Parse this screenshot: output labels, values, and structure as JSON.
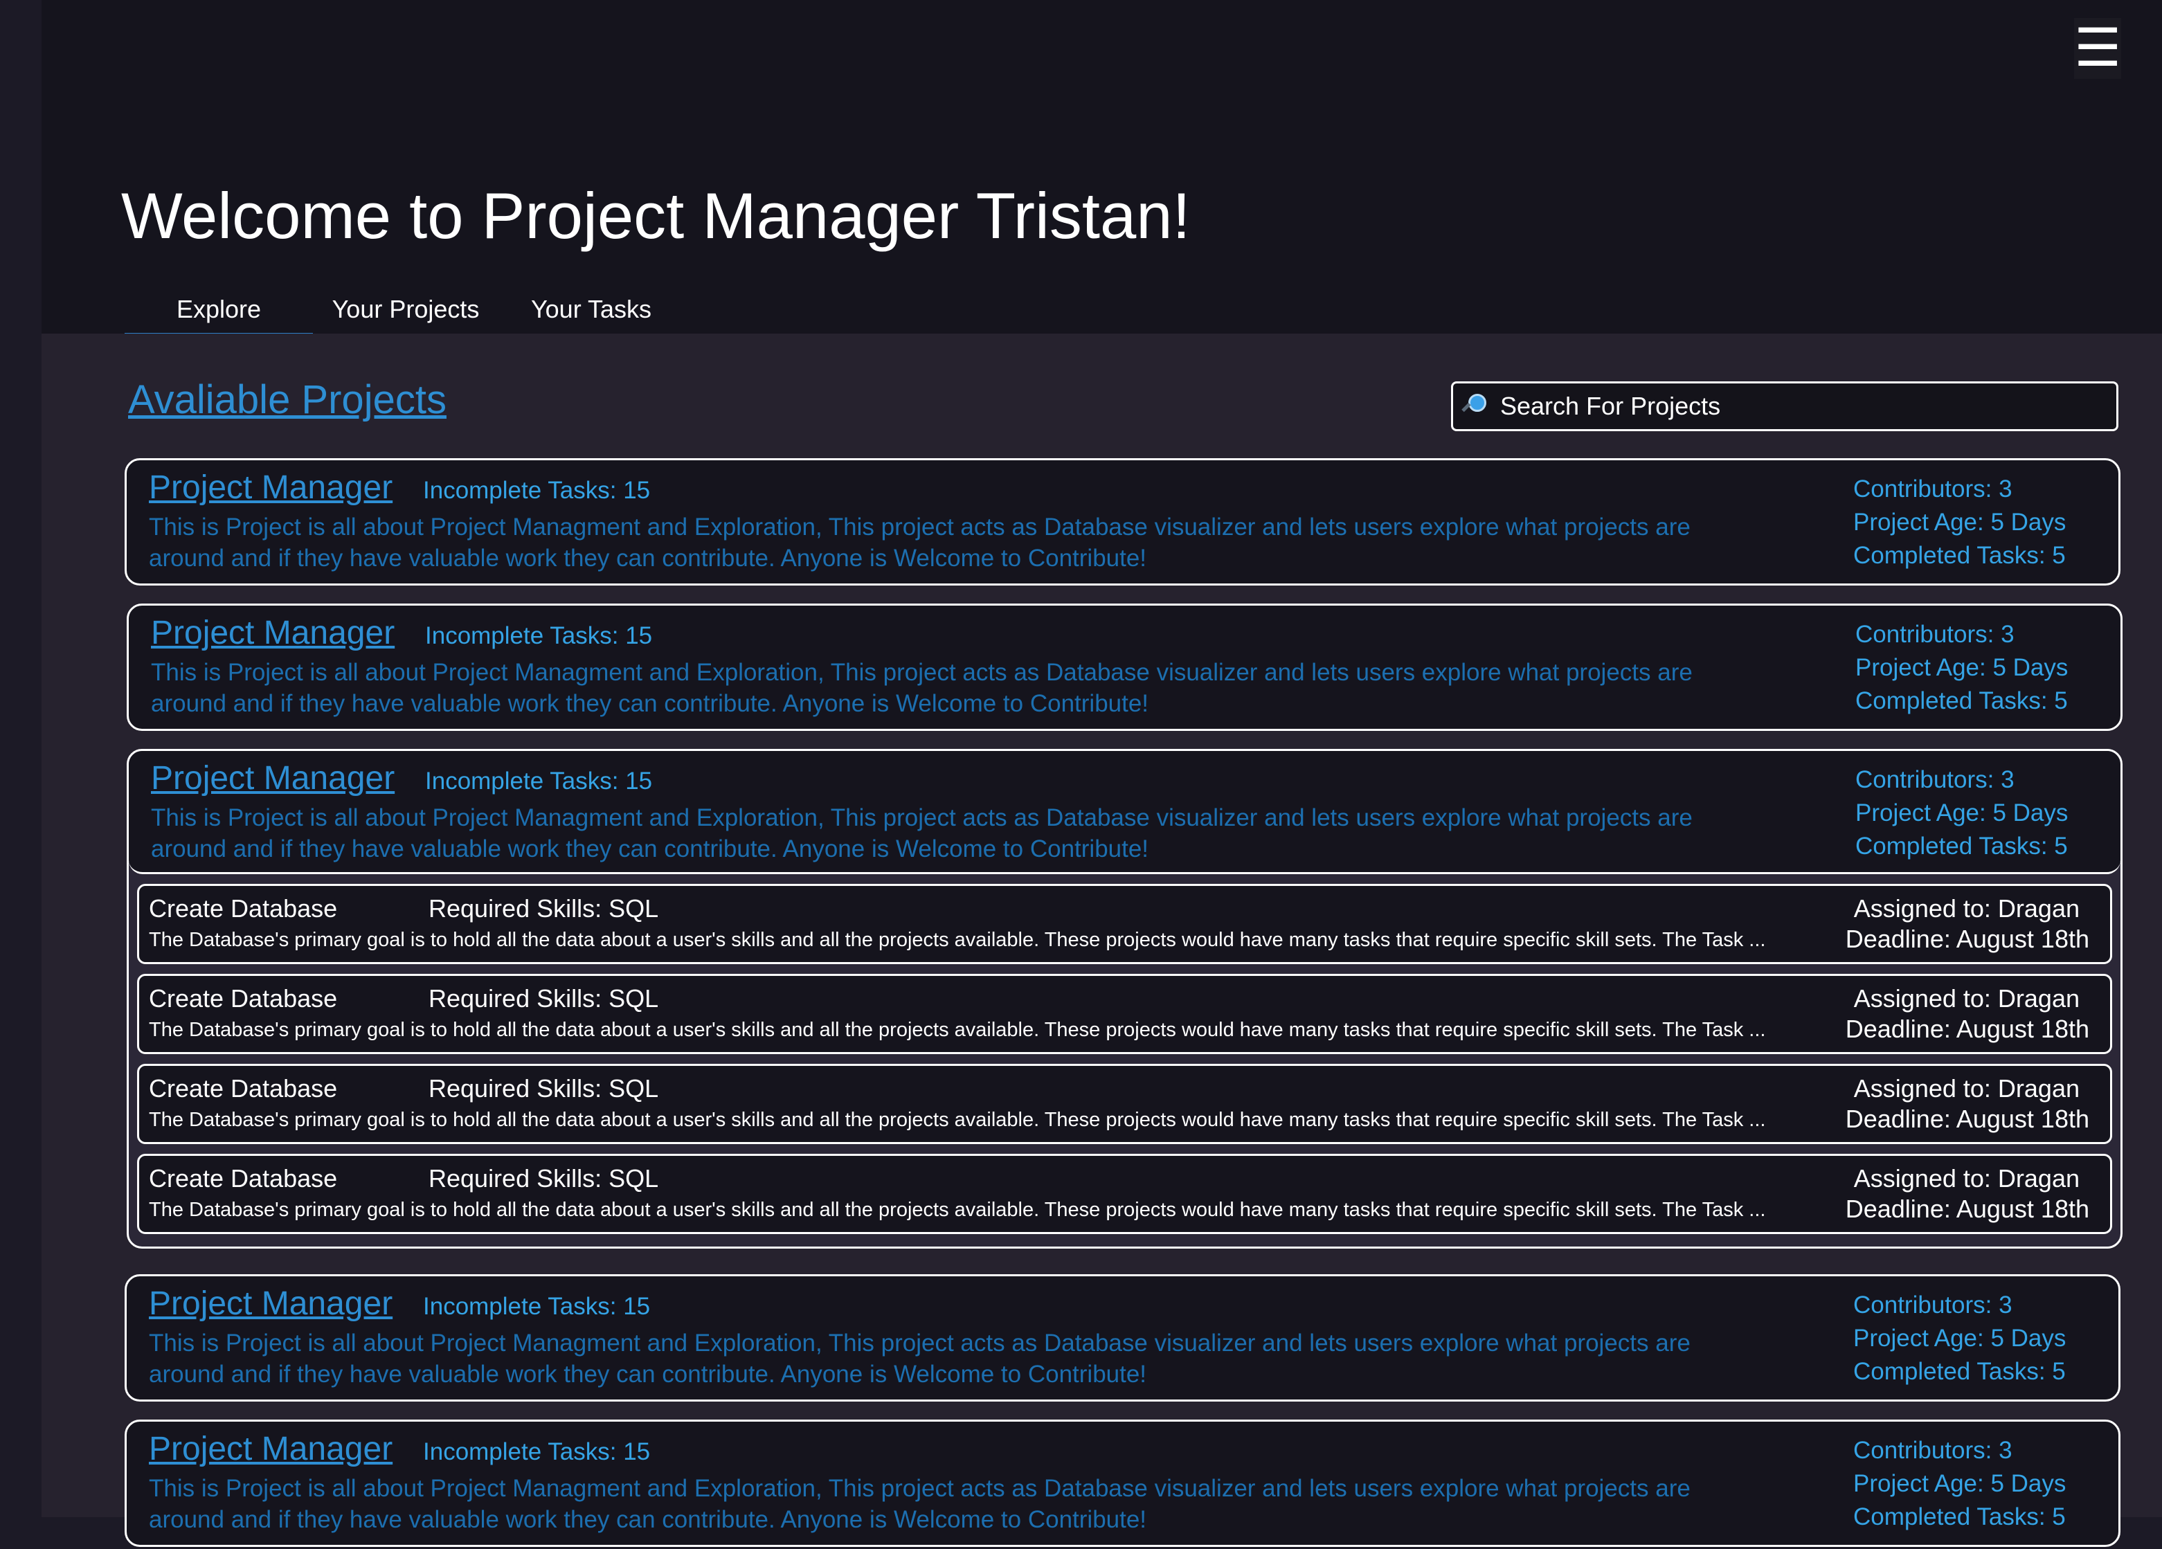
{
  "header": {
    "title": "Welcome to Project Manager Tristan!",
    "menu_icon": "hamburger-icon",
    "tabs": [
      {
        "label": "Explore",
        "active": true
      },
      {
        "label": "Your Projects",
        "active": false
      },
      {
        "label": "Your Tasks",
        "active": false
      }
    ]
  },
  "main": {
    "section_title": "Avaliable Projects",
    "search": {
      "placeholder": "Search For Projects",
      "value": "",
      "icon": "search-icon"
    },
    "projects": [
      {
        "name": "Project Manager",
        "incomplete": "Incomplete Tasks: 15",
        "description": "This is Project is all about Project Managment and Exploration, This project acts as Database visualizer and lets users explore what projects are around and if they have valuable work they can contribute. Anyone is Welcome to Contribute!",
        "contributors": "Contributors: 3",
        "age": "Project Age: 5 Days",
        "completed": "Completed Tasks: 5"
      },
      {
        "name": "Project Manager",
        "incomplete": "Incomplete Tasks: 15",
        "description": "This is Project is all about Project Managment and Exploration, This project acts as Database visualizer and lets users explore what projects are around and if they have valuable work they can contribute. Anyone is Welcome to Contribute!",
        "contributors": "Contributors: 3",
        "age": "Project Age: 5 Days",
        "completed": "Completed Tasks: 5"
      },
      {
        "name": "Project Manager",
        "incomplete": "Incomplete Tasks: 15",
        "description": "This is Project is all about Project Managment and Exploration, This project acts as Database visualizer and lets users explore what projects are around and if they have valuable work they can contribute. Anyone is Welcome to Contribute!",
        "contributors": "Contributors: 3",
        "age": "Project Age: 5 Days",
        "completed": "Completed Tasks: 5",
        "tasks": [
          {
            "name": "Create Database",
            "skills": "Required Skills: SQL",
            "description": "The Database's primary goal is to hold all the data about a user's skills and all the projects available. These projects would have many tasks that require specific skill sets. The Task ...",
            "assigned": "Assigned to: Dragan",
            "deadline": "Deadline: August 18th"
          },
          {
            "name": "Create Database",
            "skills": "Required Skills: SQL",
            "description": "The Database's primary goal is to hold all the data about a user's skills and all the projects available. These projects would have many tasks that require specific skill sets. The Task ...",
            "assigned": "Assigned to: Dragan",
            "deadline": "Deadline: August 18th"
          },
          {
            "name": "Create Database",
            "skills": "Required Skills: SQL",
            "description": "The Database's primary goal is to hold all the data about a user's skills and all the projects available. These projects would have many tasks that require specific skill sets. The Task ...",
            "assigned": "Assigned to: Dragan",
            "deadline": "Deadline: August 18th"
          },
          {
            "name": "Create Database",
            "skills": "Required Skills: SQL",
            "description": "The Database's primary goal is to hold all the data about a user's skills and all the projects available. These projects would have many tasks that require specific skill sets. The Task ...",
            "assigned": "Assigned to: Dragan",
            "deadline": "Deadline: August 18th"
          }
        ]
      },
      {
        "name": "Project Manager",
        "incomplete": "Incomplete Tasks: 15",
        "description": "This is Project is all about Project Managment and Exploration, This project acts as Database visualizer and lets users explore what projects are around and if they have valuable work they can contribute. Anyone is Welcome to Contribute!",
        "contributors": "Contributors: 3",
        "age": "Project Age: 5 Days",
        "completed": "Completed Tasks: 5"
      },
      {
        "name": "Project Manager",
        "incomplete": "Incomplete Tasks: 15",
        "description": "This is Project is all about Project Managment and Exploration, This project acts as Database visualizer and lets users explore what projects are around and if they have valuable work they can contribute. Anyone is Welcome to Contribute!",
        "contributors": "Contributors: 3",
        "age": "Project Age: 5 Days",
        "completed": "Completed Tasks: 5"
      }
    ]
  }
}
